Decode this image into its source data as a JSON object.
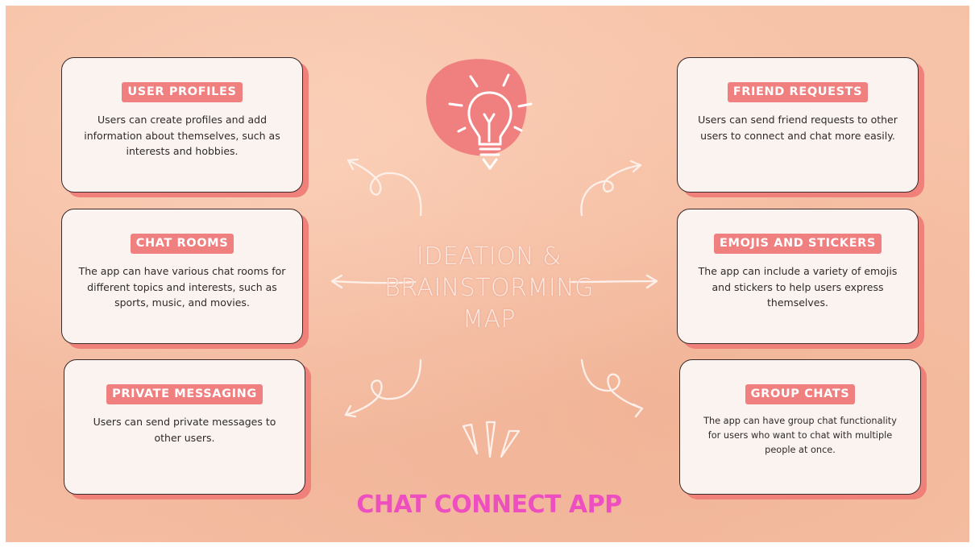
{
  "center_title": {
    "line1": "IDEATION &",
    "line2": "BRAINSTORMING",
    "line3": "MAP"
  },
  "footer_title": "CHAT CONNECT APP",
  "colors": {
    "background": "#f5c0a4",
    "card_fill": "#fbf3f0",
    "card_shadow": "#f0807a",
    "label_fill": "#f08080",
    "footer_text": "#ee4fc0",
    "icon_blob": "#f08080"
  },
  "icons": {
    "center": "lightbulb-icon"
  },
  "cards": {
    "user_profiles": {
      "label": "USER PROFILES",
      "desc": "Users can create profiles and add information about themselves, such as interests and hobbies."
    },
    "chat_rooms": {
      "label": "CHAT ROOMS",
      "desc": "The app can have various chat rooms for different topics and interests, such as sports, music, and movies."
    },
    "private_messaging": {
      "label": "PRIVATE MESSAGING",
      "desc": "Users can send private messages to other users."
    },
    "friend_requests": {
      "label": "FRIEND REQUESTS",
      "desc": "Users can send friend requests to other users to connect and chat more easily."
    },
    "emojis_stickers": {
      "label": "EMOJIS AND STICKERS",
      "desc": "The app can include a variety of emojis and stickers to help users express themselves."
    },
    "group_chats": {
      "label": "GROUP CHATS",
      "desc": "The app can have group chat functionality for users who want to chat with multiple people at once."
    }
  }
}
